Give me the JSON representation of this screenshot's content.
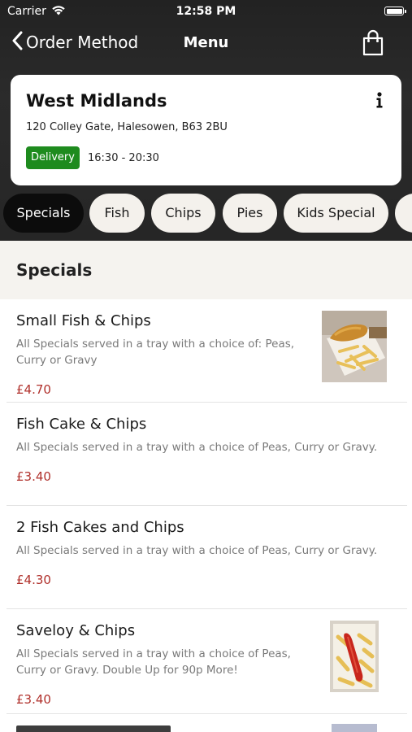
{
  "status_bar": {
    "carrier": "Carrier",
    "time": "12:58 PM"
  },
  "navbar": {
    "back_label": "Order Method",
    "title": "Menu"
  },
  "store": {
    "name": "West Midlands",
    "address": "120 Colley Gate, Halesowen, B63 2BU",
    "method_badge": "Delivery",
    "hours": "16:30 - 20:30"
  },
  "tabs": [
    "Specials",
    "Fish",
    "Chips",
    "Pies",
    "Kids Special"
  ],
  "section": {
    "title": "Specials"
  },
  "items": [
    {
      "name": "Small Fish & Chips",
      "desc_lines": [
        "All Specials served in a tray with a choice of: Peas,",
        "Curry or Gravy"
      ],
      "price": "£4.70"
    },
    {
      "name": "Fish Cake & Chips",
      "desc_lines": [
        "All Specials served in a tray with a choice of Peas, Curry or Gravy."
      ],
      "price": "£3.40"
    },
    {
      "name": "2 Fish Cakes and Chips",
      "desc_lines": [
        "All Specials served in a tray with a choice of Peas, Curry or Gravy."
      ],
      "price": "£4.30"
    },
    {
      "name": "Saveloy & Chips",
      "desc_lines": [
        "All Specials served in a tray with a choice of Peas,",
        "Curry or Gravy. Double Up for 90p More!"
      ],
      "price": "£3.40"
    }
  ],
  "colors": {
    "delivery_badge": "#1e8b1e",
    "price": "#b0302b",
    "active_tab": "#0c0c0c"
  }
}
